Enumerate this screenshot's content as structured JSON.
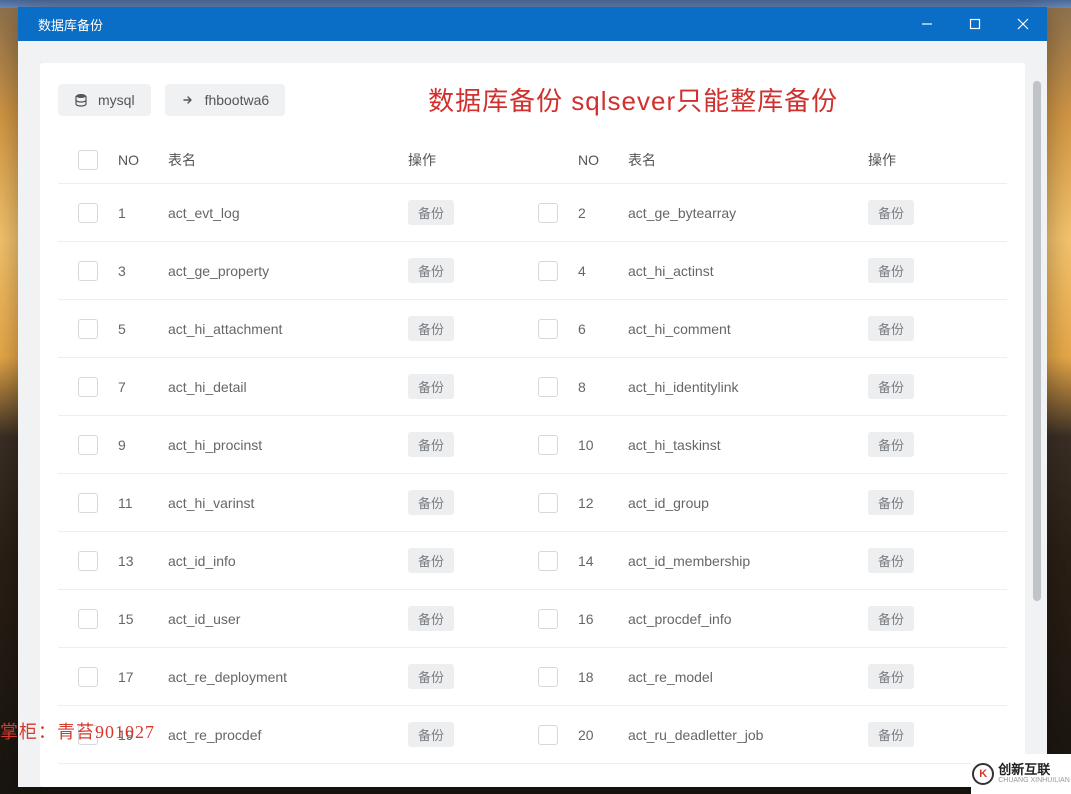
{
  "window": {
    "title": "数据库备份"
  },
  "toolbar": {
    "mysql_label": "mysql",
    "db_label": "fhbootwa6"
  },
  "header": {
    "red_title": "数据库备份  sqlsever只能整库备份"
  },
  "columns": {
    "no": "NO",
    "name": "表名",
    "action": "操作"
  },
  "action_label": "备份",
  "rows": [
    {
      "no": 1,
      "name": "act_evt_log"
    },
    {
      "no": 2,
      "name": "act_ge_bytearray"
    },
    {
      "no": 3,
      "name": "act_ge_property"
    },
    {
      "no": 4,
      "name": "act_hi_actinst"
    },
    {
      "no": 5,
      "name": "act_hi_attachment"
    },
    {
      "no": 6,
      "name": "act_hi_comment"
    },
    {
      "no": 7,
      "name": "act_hi_detail"
    },
    {
      "no": 8,
      "name": "act_hi_identitylink"
    },
    {
      "no": 9,
      "name": "act_hi_procinst"
    },
    {
      "no": 10,
      "name": "act_hi_taskinst"
    },
    {
      "no": 11,
      "name": "act_hi_varinst"
    },
    {
      "no": 12,
      "name": "act_id_group"
    },
    {
      "no": 13,
      "name": "act_id_info"
    },
    {
      "no": 14,
      "name": "act_id_membership"
    },
    {
      "no": 15,
      "name": "act_id_user"
    },
    {
      "no": 16,
      "name": "act_procdef_info"
    },
    {
      "no": 17,
      "name": "act_re_deployment"
    },
    {
      "no": 18,
      "name": "act_re_model"
    },
    {
      "no": 19,
      "name": "act_re_procdef"
    },
    {
      "no": 20,
      "name": "act_ru_deadletter_job"
    }
  ],
  "watermark": {
    "owner": "掌柜：青苔901027",
    "brand_cn": "创新互联",
    "brand_en": "CHUANG XINHUILIAN"
  }
}
